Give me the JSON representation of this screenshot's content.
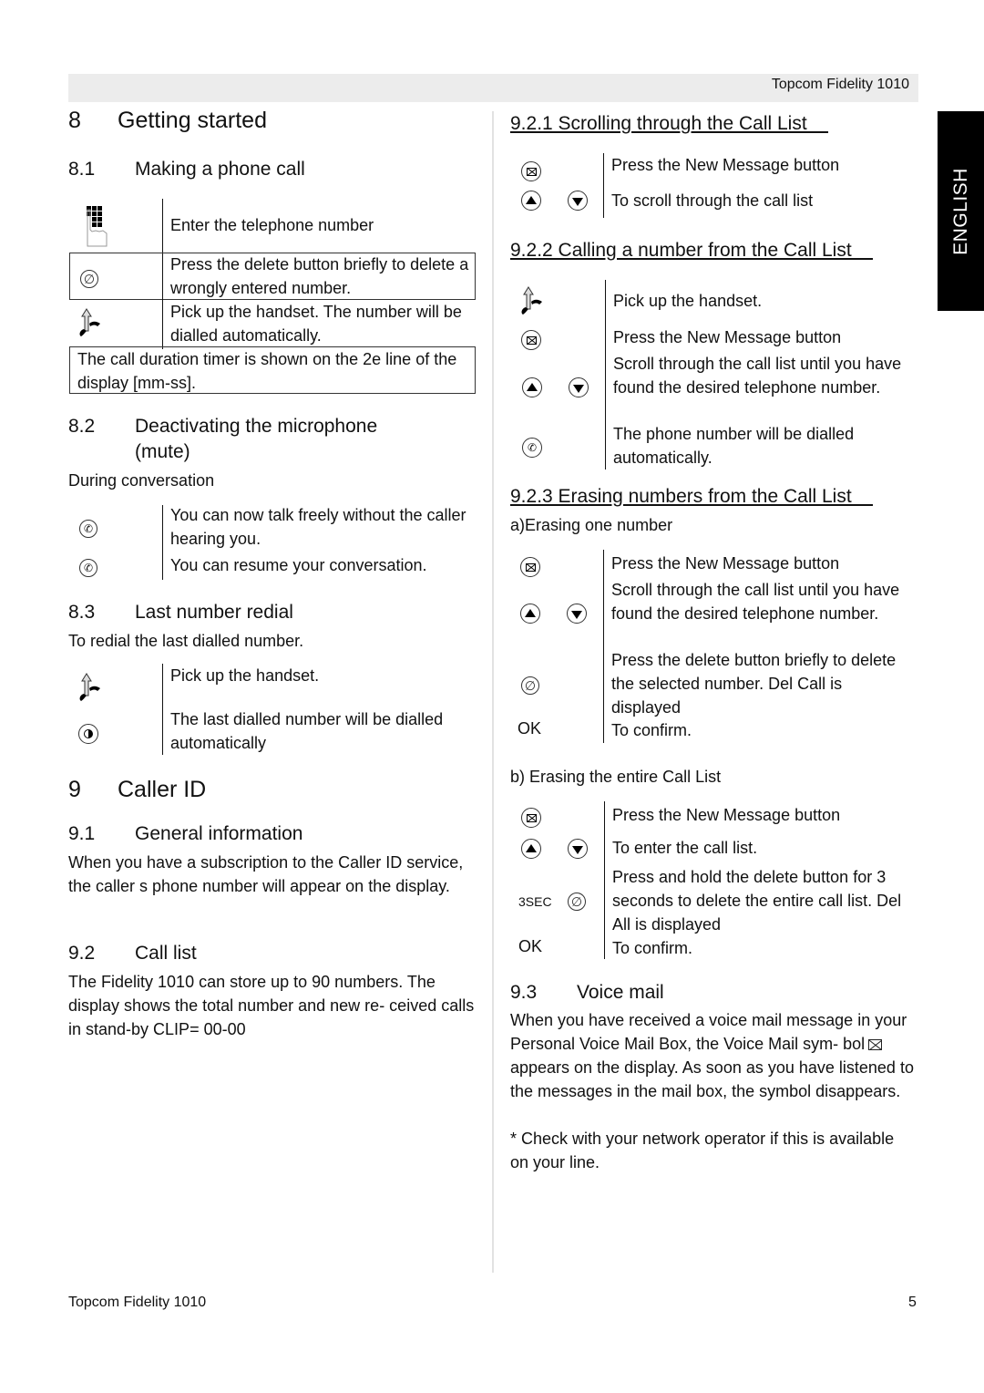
{
  "header": {
    "title": "Topcom Fidelity 1010"
  },
  "language_tab": "ENGLISH",
  "footer": {
    "left": "Topcom Fidelity 1010",
    "page_number": "5"
  },
  "sections": {
    "s8": {
      "num": "8",
      "title": "Getting started"
    },
    "s8_1": {
      "num": "8.1",
      "title": "Making a phone call",
      "steps": [
        {
          "icon": "keypad-finger-icon",
          "text": "Enter the telephone number"
        },
        {
          "icon": "delete-button-icon",
          "text": "Press the delete button briefly to delete a wrongly entered number."
        },
        {
          "icon": "pick-up-handset-icon",
          "text": "Pick up the handset. The number will be dialled automatically."
        }
      ],
      "note": "The call duration timer is shown on the 2e line of the display [mm-ss]."
    },
    "s8_2": {
      "num": "8.2",
      "title_line1": "Deactivating the microphone",
      "title_line2": "(mute)",
      "intro": "During conversation",
      "steps": [
        {
          "icon": "mute-button-icon",
          "text": "You can now talk freely without the caller hearing you."
        },
        {
          "icon": "mute-button-icon",
          "text": "You can resume your conversation."
        }
      ]
    },
    "s8_3": {
      "num": "8.3",
      "title": "Last number redial",
      "intro": "To redial the last dialled number.",
      "steps": [
        {
          "icon": "pick-up-handset-icon",
          "text": "Pick up the handset."
        },
        {
          "icon": "redial-button-icon",
          "text": "The last dialled number will be dialled automatically"
        }
      ]
    },
    "s9": {
      "num": "9",
      "title": "Caller ID"
    },
    "s9_1": {
      "num": "9.1",
      "title": "General information",
      "body": "When you have a subscription to the Caller ID service, the caller s phone number will appear on the display."
    },
    "s9_2": {
      "num": "9.2",
      "title": "Call list",
      "body": "The Fidelity 1010 can store up to 90 numbers. The display shows the total number and new re- ceived calls in stand-by  CLIP= 00-00"
    },
    "s9_2_1": {
      "title": "9.2.1 Scrolling through the Call List    ",
      "steps": [
        {
          "icon": "new-message-button-icon",
          "text": "Press the New Message button"
        },
        {
          "icon": "up-down-arrow-buttons-icon",
          "text": "To scroll through the call list"
        }
      ]
    },
    "s9_2_2": {
      "title": "9.2.2 Calling a number from the Call List    ",
      "steps": [
        {
          "icon": "pick-up-handset-icon",
          "text": "Pick up the handset."
        },
        {
          "icon": "new-message-button-icon",
          "text": "Press the New Message button"
        },
        {
          "icon": "up-down-arrow-buttons-icon",
          "text": "Scroll through the call list until you have found the desired telephone number."
        },
        {
          "icon": "dial-button-icon",
          "text": "The phone number will be dialled automatically."
        }
      ]
    },
    "s9_2_3": {
      "title": "9.2.3 Erasing numbers from the Call List    ",
      "sub_a": "a)Erasing one number",
      "steps_a": [
        {
          "icon": "new-message-button-icon",
          "text": "Press the New Message button"
        },
        {
          "icon": "up-down-arrow-buttons-icon",
          "text": "Scroll through the call list until you have found the desired telephone number."
        },
        {
          "icon": "delete-button-icon",
          "text": "Press the delete button briefly to delete the selected number.  Del Call   is displayed"
        },
        {
          "label": "OK",
          "text": "To confirm."
        }
      ],
      "sub_b": "b) Erasing the entire Call List",
      "steps_b": [
        {
          "icon": "new-message-button-icon",
          "text": "Press the New Message button"
        },
        {
          "icon": "up-down-arrow-buttons-icon",
          "text": "To enter the call list."
        },
        {
          "label": "3SEC",
          "icon": "delete-button-icon",
          "text": "Press and hold the delete button for 3 seconds to delete the entire call list.  Del All   is displayed"
        },
        {
          "label": "OK",
          "text": "To confirm."
        }
      ]
    },
    "s9_3": {
      "num": "9.3",
      "title": "Voice mail",
      "body_before_icon": "When you have received a voice mail message in your Personal Voice Mail Box, the Voice Mail sym- bol",
      "body_after_icon": "appears on the display. As soon as you have listened to the messages in the mail box, the symbol disappears.",
      "footnote": "* Check with your network operator if this is available on your line."
    }
  }
}
